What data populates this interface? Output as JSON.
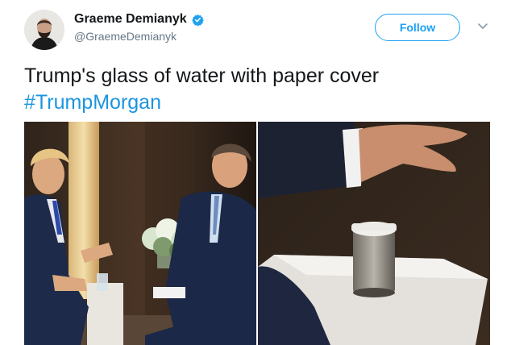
{
  "user": {
    "display_name": "Graeme Demianyk",
    "handle": "@GraemeDemianyk",
    "verified": true
  },
  "follow_label": "Follow",
  "tweet": {
    "text": "Trump's glass of water with paper cover",
    "hashtag": "#TrumpMorgan"
  },
  "icons": [
    "verified-badge-icon",
    "chevron-down-icon"
  ],
  "colors": {
    "accent": "#1da1f2",
    "hashtag": "#1b95e0",
    "text": "#14171a",
    "secondary": "#657786"
  }
}
